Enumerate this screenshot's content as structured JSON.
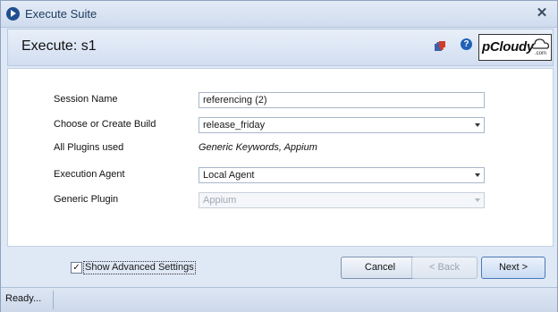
{
  "window": {
    "title": "Execute Suite"
  },
  "header": {
    "title": "Execute: s1",
    "logo_text": "pCloudy",
    "logo_suffix": ".com"
  },
  "form": {
    "session_name": {
      "label": "Session Name",
      "value": "referencing (2)"
    },
    "build": {
      "label": "Choose or Create Build",
      "value": "release_friday"
    },
    "plugins": {
      "label": "All Plugins used",
      "value": "Generic Keywords, Appium"
    },
    "agent": {
      "label": "Execution Agent",
      "value": "Local Agent"
    },
    "generic_plugin": {
      "label": "Generic Plugin",
      "value": "Appium"
    }
  },
  "footer": {
    "show_advanced": {
      "label": "Show Advanced Settings",
      "checked": true
    },
    "cancel": "Cancel",
    "back": "< Back",
    "next": "Next >"
  },
  "status": {
    "text": "Ready..."
  },
  "icons": {
    "app": "play-icon",
    "close": "close-icon",
    "plugin": "puzzle-icon",
    "help": "help-icon",
    "logo": "pcloudy-logo"
  },
  "colors": {
    "accent": "#2060b8",
    "panel": "#dfe8f5"
  }
}
